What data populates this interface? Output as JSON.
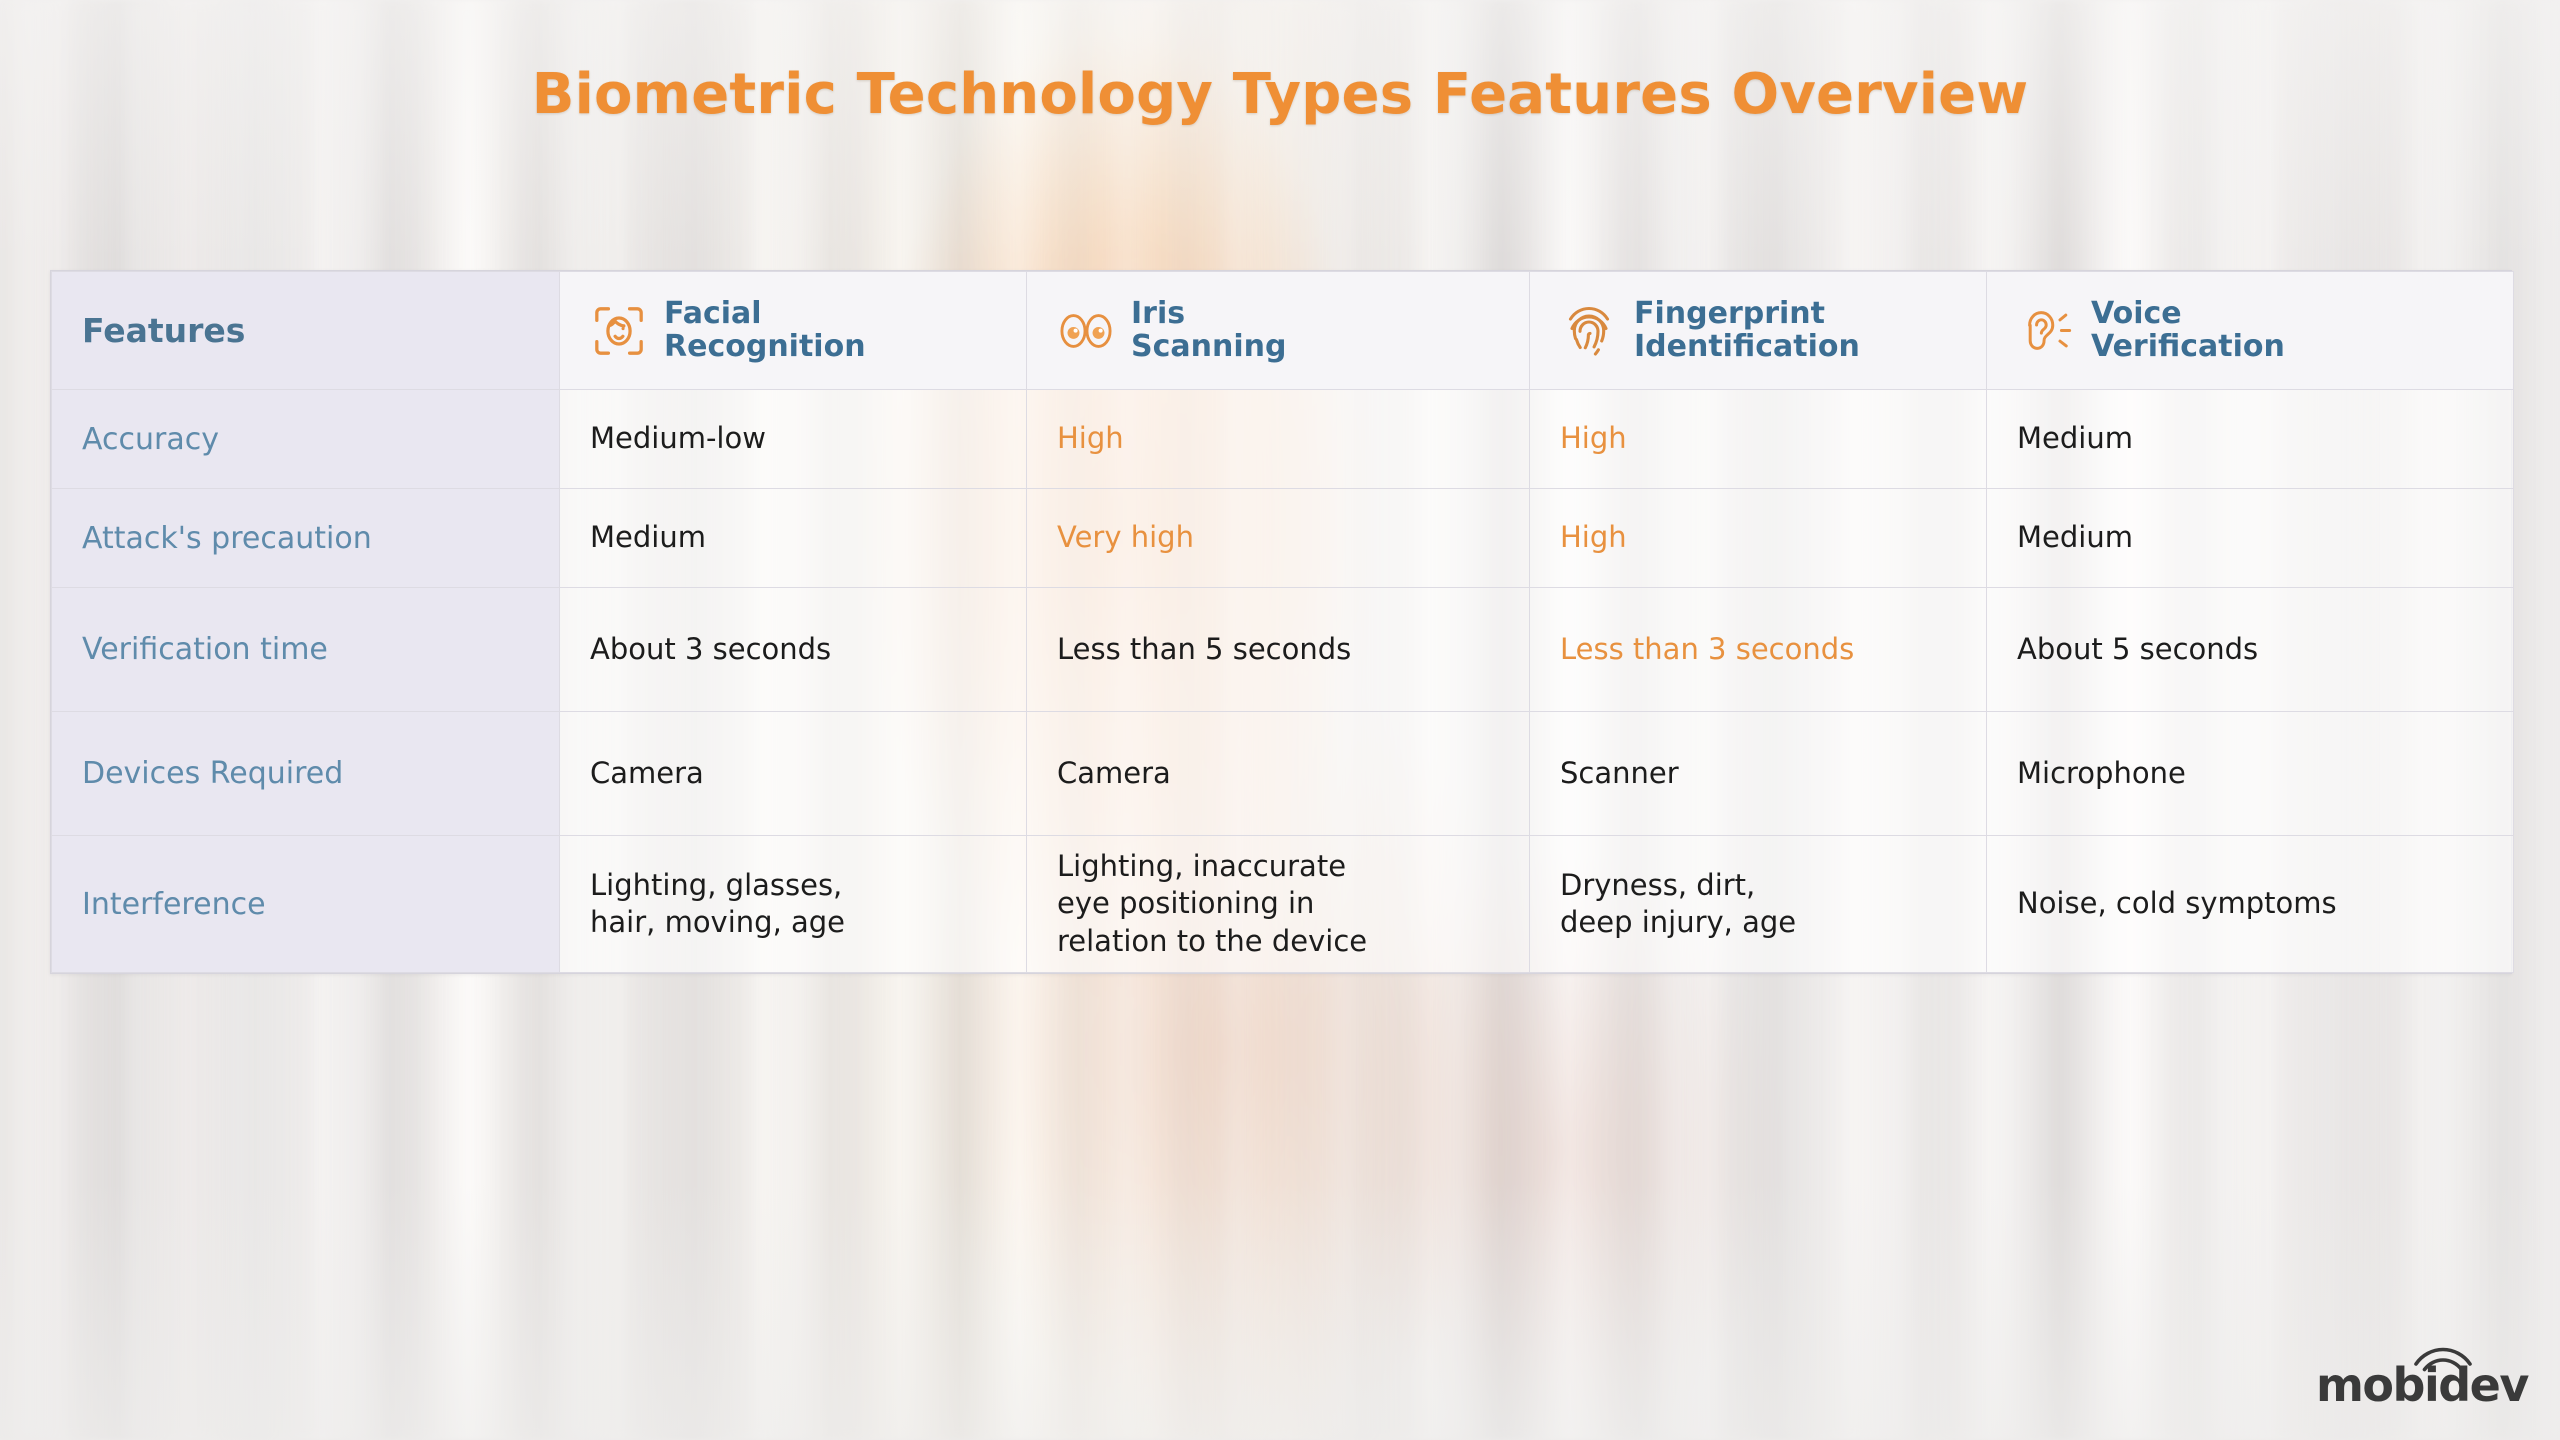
{
  "page": {
    "title": "Biometric Technology Types Features Overview",
    "accent_color": "#ef8f35",
    "header_text_color": "#3c6e93",
    "row_label_color": "#5f8bab",
    "label_cell_bg": "#e9e7f1",
    "value_cell_bg": "#ffffff"
  },
  "table": {
    "columns": [
      {
        "id": "features",
        "label": "Features",
        "icon": ""
      },
      {
        "id": "facial",
        "label": "Facial\nRecognition",
        "icon": "face-scan-icon"
      },
      {
        "id": "iris",
        "label": "Iris\nScanning",
        "icon": "eyes-icon"
      },
      {
        "id": "fingerprint",
        "label": "Fingerprint\nIdentification",
        "icon": "fingerprint-icon"
      },
      {
        "id": "voice",
        "label": "Voice\nVerification",
        "icon": "ear-sound-icon"
      }
    ],
    "rows": [
      {
        "label": "Accuracy",
        "cells": [
          {
            "text": "Medium-low",
            "accent": false
          },
          {
            "text": "High",
            "accent": true
          },
          {
            "text": "High",
            "accent": true
          },
          {
            "text": "Medium",
            "accent": false
          }
        ]
      },
      {
        "label": "Attack's precaution",
        "cells": [
          {
            "text": "Medium",
            "accent": false
          },
          {
            "text": "Very high",
            "accent": true
          },
          {
            "text": "High",
            "accent": true
          },
          {
            "text": "Medium",
            "accent": false
          }
        ]
      },
      {
        "label": "Verification time",
        "cells": [
          {
            "text": "About 3 seconds",
            "accent": false
          },
          {
            "text": "Less than 5 seconds",
            "accent": false
          },
          {
            "text": "Less than 3 seconds",
            "accent": true
          },
          {
            "text": "About 5 seconds",
            "accent": false
          }
        ]
      },
      {
        "label": "Devices Required",
        "cells": [
          {
            "text": "Camera",
            "accent": false
          },
          {
            "text": "Camera",
            "accent": false
          },
          {
            "text": "Scanner",
            "accent": false
          },
          {
            "text": "Microphone",
            "accent": false
          }
        ]
      },
      {
        "label": "Interference",
        "cells": [
          {
            "text": "Lighting, glasses,\nhair, moving, age",
            "accent": false
          },
          {
            "text": "Lighting, inaccurate\neye positioning in\nrelation to the device",
            "accent": false
          },
          {
            "text": "Dryness, dirt,\ndeep injury, age",
            "accent": false
          },
          {
            "text": "Noise, cold symptoms",
            "accent": false
          }
        ]
      }
    ]
  },
  "logo": {
    "text": "mobidev",
    "icon": "wifi-arcs-icon"
  }
}
